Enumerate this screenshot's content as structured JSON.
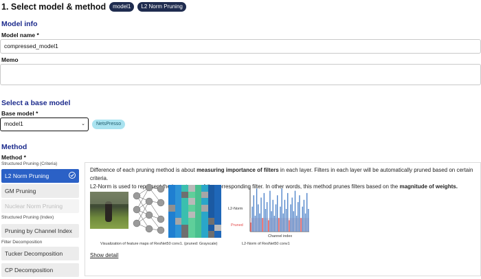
{
  "header": {
    "title": "1. Select model & method",
    "badges": [
      "model1",
      "L2 Norm Pruning"
    ]
  },
  "model_info": {
    "heading": "Model info",
    "name_label": "Model name *",
    "name_value": "compressed_model1",
    "memo_label": "Memo",
    "memo_value": ""
  },
  "base_model": {
    "heading": "Select a base model",
    "label": "Base model *",
    "selected": "model1",
    "tag": "NetsPresso"
  },
  "method": {
    "heading": "Method",
    "label": "Method *",
    "group1": "Structured Pruning (Criteria)",
    "l2": "L2 Norm Pruning",
    "gm": "GM Pruning",
    "nuclear": "Nuclear Norm Pruning",
    "group2": "Structured Pruning (Index)",
    "channel": "Pruning by Channel Index",
    "group3": "Filter Decomposition",
    "tucker": "Tucker Decomposition",
    "cp": "CP Decomposition"
  },
  "detail": {
    "line1_a": "Difference of each pruning method is about ",
    "line1_b": "measuring importance of filters",
    "line1_c": " in each layer. Filters in each layer will be automatically pruned based on certain criteria.",
    "line2_a": "L2-Norm is used to represent the importance of the corresponding filter. In other words, this method prunes filters based on the ",
    "line2_b": "magnitude of weights.",
    "caption1": "Visualization of feature maps of ResNet50 conv1. (pruned: Grayscale)",
    "caption2": "L2-Norm of ResNet50 conv1",
    "y_label": "L2-Norm",
    "pruned_label": "Pruned",
    "x_label": "Channel index",
    "show_detail": "Show detail"
  },
  "colors": {
    "accent": "#2b61c6",
    "heading": "#1b2a8c",
    "badge": "#1f2c4f",
    "tag_bg": "#a9e3f0",
    "bar": "#4a80c8",
    "pruned": "#e34848"
  },
  "chart_data": {
    "type": "bar",
    "title": "L2-Norm of ResNet50 conv1",
    "xlabel": "Channel index",
    "ylabel": "L2-Norm",
    "values": [
      0.2,
      0.55,
      0.8,
      0.35,
      0.95,
      0.6,
      0.4,
      0.75,
      0.3,
      0.85,
      0.5,
      0.65,
      0.25,
      0.9,
      0.45,
      0.7,
      0.35,
      0.6,
      0.8,
      0.3,
      0.55,
      0.95,
      0.4,
      0.7,
      0.5,
      0.85,
      0.25,
      0.6,
      0.75,
      0.45,
      0.9,
      0.35,
      0.65,
      0.8,
      0.3,
      0.55,
      0.7,
      0.4,
      0.85,
      0.5
    ],
    "pruned_threshold": 0.3
  }
}
